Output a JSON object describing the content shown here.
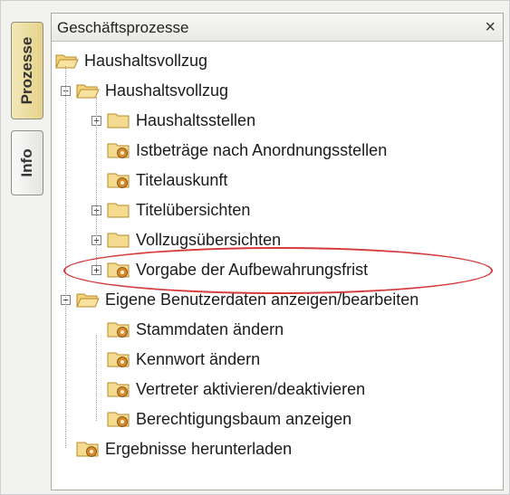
{
  "tabs": [
    {
      "label": "Prozesse",
      "active": true
    },
    {
      "label": "Info",
      "active": false
    }
  ],
  "panel": {
    "title": "Geschäftsprozesse",
    "close_label": "×"
  },
  "tree": [
    {
      "label": "Haushaltsvollzug",
      "icon": "folder-open-icon",
      "expander": null
    },
    {
      "label": "Haushaltsvollzug",
      "icon": "folder-open-icon",
      "expander": "−"
    },
    {
      "label": "Haushaltsstellen",
      "icon": "folder-icon",
      "expander": "+"
    },
    {
      "label": "Istbeträge nach Anordnungsstellen",
      "icon": "process-folder-icon",
      "expander": null
    },
    {
      "label": "Titelauskunft",
      "icon": "process-folder-icon",
      "expander": null
    },
    {
      "label": "Titelübersichten",
      "icon": "folder-icon",
      "expander": "+"
    },
    {
      "label": "Vollzugsübersichten",
      "icon": "folder-icon",
      "expander": "+"
    },
    {
      "label": "Vorgabe der Aufbewahrungsfrist",
      "icon": "process-folder-icon",
      "expander": "+"
    },
    {
      "label": "Eigene Benutzerdaten anzeigen/bearbeiten",
      "icon": "folder-open-icon",
      "expander": "−"
    },
    {
      "label": "Stammdaten ändern",
      "icon": "process-folder-icon",
      "expander": null
    },
    {
      "label": "Kennwort ändern",
      "icon": "process-folder-icon",
      "expander": null
    },
    {
      "label": "Vertreter aktivieren/deaktivieren",
      "icon": "process-folder-icon",
      "expander": null
    },
    {
      "label": "Berechtigungsbaum anzeigen",
      "icon": "process-folder-icon",
      "expander": null
    },
    {
      "label": "Ergebnisse herunterladen",
      "icon": "process-folder-icon",
      "expander": null
    }
  ],
  "annotation": {
    "color": "#d63a3a",
    "highlighted_item": "Vorgabe der Aufbewahrungsfrist"
  }
}
